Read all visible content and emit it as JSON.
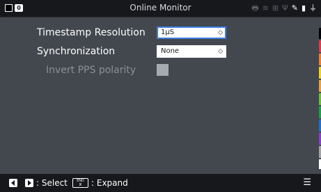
{
  "window": {
    "title": "Online Monitor"
  },
  "topbar": {
    "badge": "0",
    "icons": [
      "printer-icon",
      "wifi-icon",
      "network-icon",
      "usb-icon",
      "wrench-icon",
      "sd-card-icon",
      "power-plug-icon"
    ]
  },
  "settings": {
    "timestamp_resolution": {
      "label": "Timestamp Resolution",
      "value": "1µS"
    },
    "synchronization": {
      "label": "Synchronization",
      "value": "None"
    },
    "invert_pps": {
      "label": "Invert PPS polarity",
      "checked": false,
      "enabled": false
    }
  },
  "bottombar": {
    "select_hint": ": Select",
    "expand_hint": ": Expand",
    "end_key": {
      "top": "END",
      "bottom": "x"
    }
  },
  "colors": {
    "background": "#43474e",
    "bar": "#17181b",
    "focus": "#3c7fe0",
    "strip": [
      "#e8374a",
      "#f07f2a",
      "#f4d21b",
      "#6cbf3b",
      "#18a34a",
      "#1f6fd1",
      "#8d3fc6",
      "#a3a3a3"
    ]
  }
}
